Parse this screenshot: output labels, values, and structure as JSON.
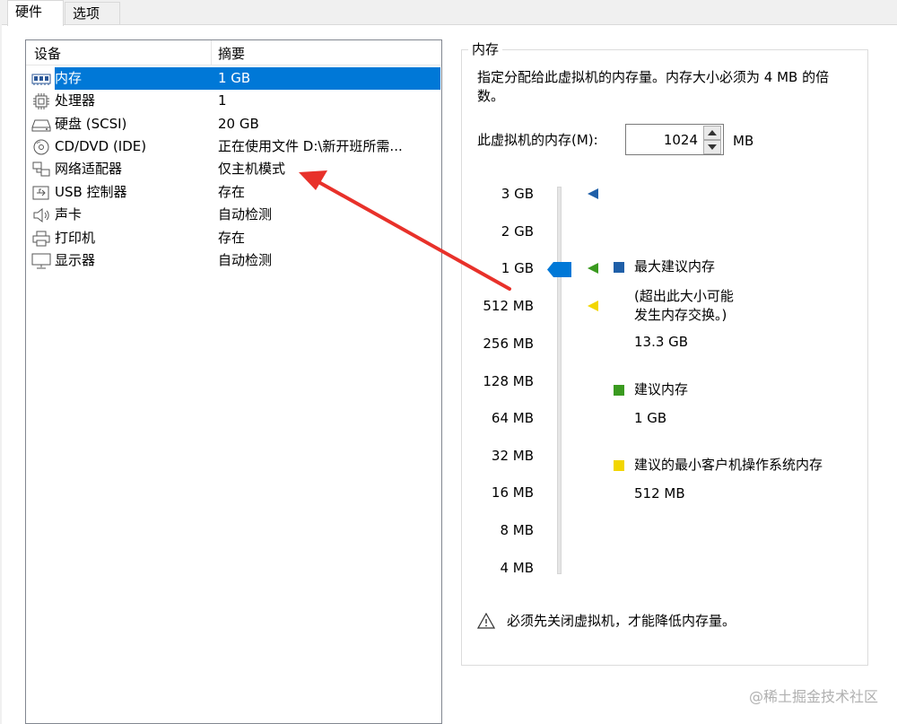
{
  "tabs": [
    {
      "label": "硬件"
    },
    {
      "label": "选项"
    }
  ],
  "device_list": {
    "col_device": "设备",
    "col_summary": "摘要",
    "rows": [
      {
        "name": "内存",
        "summary": "1 GB",
        "icon": "memory-icon",
        "selected": true
      },
      {
        "name": "处理器",
        "summary": "1",
        "icon": "processor-icon"
      },
      {
        "name": "硬盘 (SCSI)",
        "summary": "20 GB",
        "icon": "harddisk-icon"
      },
      {
        "name": "CD/DVD (IDE)",
        "summary": "正在使用文件 D:\\新开班所需...",
        "icon": "cd-dvd-icon"
      },
      {
        "name": "网络适配器",
        "summary": "仅主机模式",
        "icon": "network-adapter-icon"
      },
      {
        "name": "USB 控制器",
        "summary": "存在",
        "icon": "usb-icon"
      },
      {
        "name": "声卡",
        "summary": "自动检测",
        "icon": "sound-card-icon"
      },
      {
        "name": "打印机",
        "summary": "存在",
        "icon": "printer-icon"
      },
      {
        "name": "显示器",
        "summary": "自动检测",
        "icon": "display-icon"
      }
    ]
  },
  "memory": {
    "group_title": "内存",
    "description": "指定分配给此虚拟机的内存量。内存大小必须为 4 MB 的倍数。",
    "input_label": "此虚拟机的内存(M):",
    "input_value": "1024",
    "unit": "MB",
    "slider_ticks": [
      "3 GB",
      "2 GB",
      "1 GB",
      "512 MB",
      "256 MB",
      "128 MB",
      "64 MB",
      "32 MB",
      "16 MB",
      "8 MB",
      "4 MB"
    ],
    "legend": {
      "max_recommended_title": "最大建议内存",
      "max_recommended_note": "(超出此大小可能\n发生内存交换。)",
      "max_recommended_value": "13.3 GB",
      "recommended_title": "建议内存",
      "recommended_value": "1 GB",
      "min_guest_title": "建议的最小客户机操作系统内存",
      "min_guest_value": "512 MB"
    },
    "warning": "必须先关闭虚拟机，才能降低内存量。"
  },
  "watermark": "@稀土掘金技术社区",
  "colors": {
    "selection": "#0078d7",
    "max_recommended": "#1f5fa8",
    "recommended": "#3a9a1f",
    "min_guest": "#f2d600",
    "arrow": "#e8312a"
  }
}
